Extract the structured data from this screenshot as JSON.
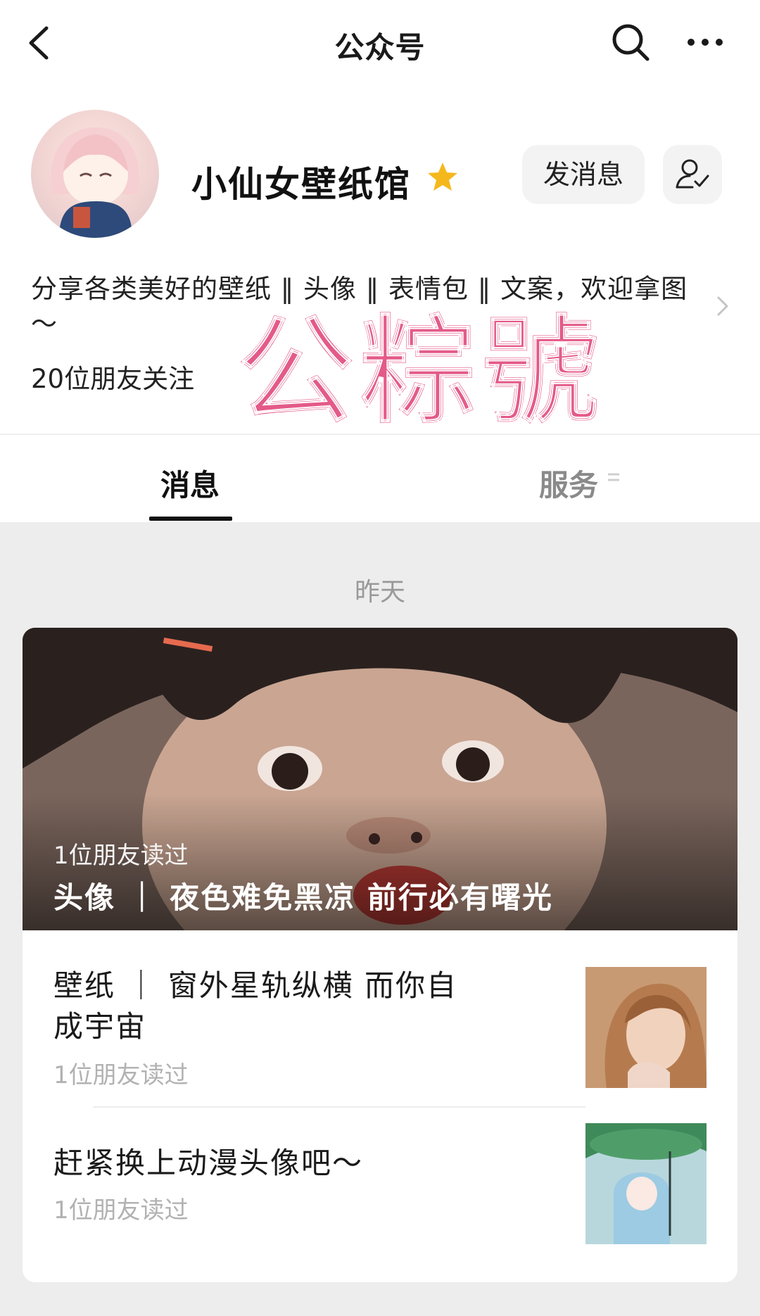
{
  "nav": {
    "title": "公众号",
    "back_icon": "chevron-left-icon",
    "search_icon": "search-icon",
    "more_icon": "more-dots-icon"
  },
  "profile": {
    "name": "小仙女壁纸馆",
    "verified_icon": "star-icon",
    "send_message_label": "发消息",
    "follow_icon": "user-check-icon",
    "description": "分享各类美好的壁纸 ‖ 头像 ‖ 表情包 ‖ 文案，欢迎拿图～",
    "followers": "20位朋友关注"
  },
  "watermark": "公粽號",
  "tabs": {
    "messages": "消息",
    "services": "服务"
  },
  "feed": {
    "date": "昨天",
    "cover": {
      "reads": "1位朋友读过",
      "title": "头像 ｜ 夜色难免黑凉 前行必有曙光"
    },
    "items": [
      {
        "title": "壁纸 ｜ 窗外星轨纵横 而你自成宇宙",
        "reads": "1位朋友读过"
      },
      {
        "title": "赶紧换上动漫头像吧～",
        "reads": "1位朋友读过"
      }
    ]
  },
  "colors": {
    "watermark": "#e45a88",
    "star": "#f5b81c",
    "background": "#ededed"
  }
}
